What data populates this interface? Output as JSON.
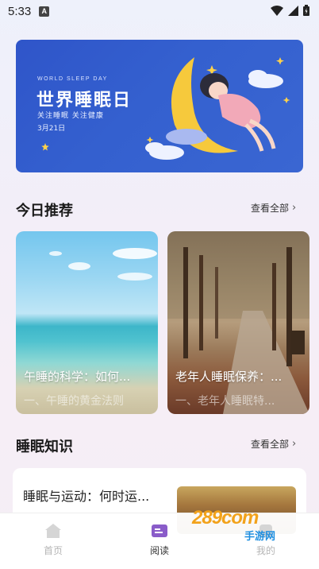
{
  "status_bar": {
    "time": "5:33",
    "notification_badge": "A",
    "icons": [
      "wifi-icon",
      "signal-icon",
      "battery-icon"
    ]
  },
  "banner": {
    "event_en": "WORLD SLEEP DAY",
    "title": "世界睡眠日",
    "subtitle": "关注睡眠  关注健康",
    "date": "3月21日",
    "background_color": "#3460cf"
  },
  "today_section": {
    "title": "今日推荐",
    "see_all": "查看全部",
    "cards": [
      {
        "title": "午睡的科学：如何...",
        "subtitle": "一、午睡的黄金法则"
      },
      {
        "title": "老年人睡眠保养：...",
        "subtitle": "一、老年人睡眠特..."
      }
    ]
  },
  "knowledge_section": {
    "title": "睡眠知识",
    "see_all": "查看全部",
    "items": [
      {
        "title": "睡眠与运动：何时运..."
      }
    ]
  },
  "bottom_nav": {
    "items": [
      {
        "label": "首页",
        "icon": "home-icon",
        "active": false
      },
      {
        "label": "阅读",
        "icon": "book-icon",
        "active": true
      },
      {
        "label": "我的",
        "icon": "user-icon",
        "active": false
      }
    ],
    "active_color": "#8a5cc9"
  },
  "watermark": {
    "text": "289com",
    "sub": "手游网"
  }
}
